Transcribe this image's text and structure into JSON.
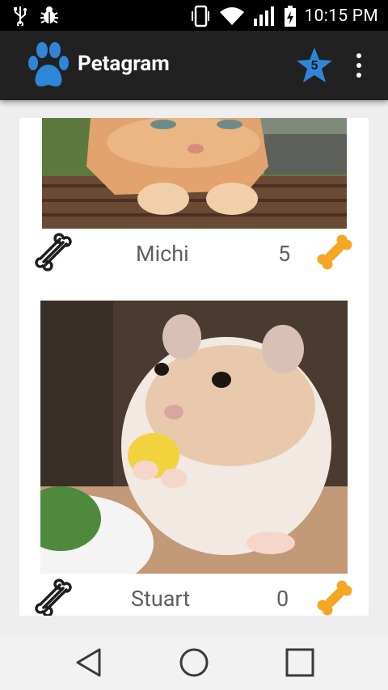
{
  "status_bar": {
    "time": "10:15 PM"
  },
  "app_bar": {
    "title": "Petagram",
    "favorites_count": "5"
  },
  "pets": [
    {
      "name": "Michi",
      "likes": "5"
    },
    {
      "name": "Stuart",
      "likes": "0"
    }
  ],
  "colors": {
    "toolbar": "#212121",
    "accent": "#f5a623",
    "star": "#2f86d6",
    "paw": "#2f86d6"
  },
  "icons": [
    "usb-icon",
    "bug-icon",
    "vibrate-icon",
    "wifi-icon",
    "signal-icon",
    "battery-icon",
    "paw-logo-icon",
    "star-icon",
    "overflow-menu-icon",
    "bone-outline-icon",
    "bone-filled-icon",
    "back-icon",
    "home-icon",
    "recents-icon"
  ]
}
